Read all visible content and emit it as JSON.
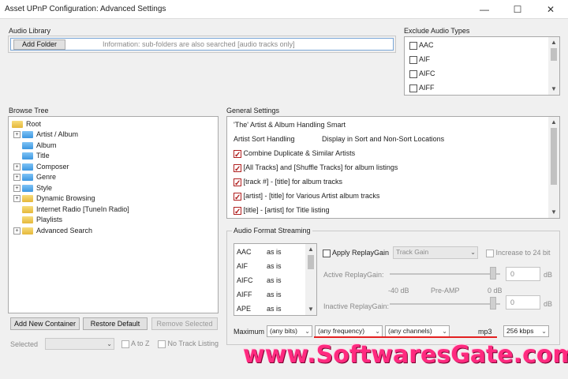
{
  "window": {
    "title": "Asset UPnP Configuration: Advanced Settings",
    "minimize": "—",
    "maximize": "☐",
    "close": "✕"
  },
  "audio_library": {
    "label": "Audio Library",
    "add_folder": "Add Folder",
    "info": "Information: sub-folders are also searched [audio tracks only]"
  },
  "exclude_audio_types": {
    "label": "Exclude Audio Types",
    "items": [
      "AAC",
      "AIF",
      "AIFC",
      "AIFF"
    ]
  },
  "browse_tree": {
    "label": "Browse Tree",
    "root": "Root",
    "items": [
      {
        "label": "Artist / Album",
        "expand": "+",
        "color": "blue"
      },
      {
        "label": "Album",
        "expand": "",
        "color": "blue"
      },
      {
        "label": "Title",
        "expand": "",
        "color": "blue"
      },
      {
        "label": "Composer",
        "expand": "+",
        "color": "blue"
      },
      {
        "label": "Genre",
        "expand": "+",
        "color": "blue"
      },
      {
        "label": "Style",
        "expand": "+",
        "color": "blue"
      },
      {
        "label": "Dynamic Browsing",
        "expand": "+",
        "color": "yellow"
      },
      {
        "label": "Internet Radio [TuneIn Radio]",
        "expand": "",
        "color": "yellow"
      },
      {
        "label": "Playlists",
        "expand": "",
        "color": "yellow"
      },
      {
        "label": "Advanced Search",
        "expand": "+",
        "color": "yellow"
      }
    ],
    "add_container": "Add New Container",
    "restore_default": "Restore Default",
    "remove_selected": "Remove Selected",
    "selected_label": "Selected",
    "a_to_z": "A to Z",
    "no_track_listing": "No Track Listing"
  },
  "general_settings": {
    "label": "General Settings",
    "rows": [
      {
        "text": "'The' Artist & Album Handling",
        "value": "Smart",
        "checkbox": false
      },
      {
        "text": "Artist Sort Handling",
        "value": "Display in Sort and Non-Sort Locations",
        "checkbox": false
      },
      {
        "text": "Combine Duplicate & Similar Artists",
        "value": "",
        "checkbox": true
      },
      {
        "text": "[All Tracks] and [Shuffle Tracks] for album listings",
        "value": "",
        "checkbox": true
      },
      {
        "text": "[track #] - [title] for album tracks",
        "value": "",
        "checkbox": true
      },
      {
        "text": "[artist] - [title] for Various Artist album tracks",
        "value": "",
        "checkbox": true
      },
      {
        "text": "[title] - [artist] for Title listing",
        "value": "",
        "checkbox": true
      }
    ]
  },
  "audio_format_streaming": {
    "label": "Audio Format Streaming",
    "formats": [
      {
        "name": "AAC",
        "mode": "as is"
      },
      {
        "name": "AIF",
        "mode": "as is"
      },
      {
        "name": "AIFC",
        "mode": "as is"
      },
      {
        "name": "AIFF",
        "mode": "as is"
      },
      {
        "name": "APE",
        "mode": "as is"
      }
    ],
    "apply_replaygain": "Apply ReplayGain",
    "track_gain": "Track Gain",
    "increase_24bit": "Increase to 24 bit",
    "active_replaygain": "Active ReplayGain:",
    "inactive_replaygain": "Inactive ReplayGain:",
    "minus40": "-40 dB",
    "preamp": "Pre-AMP",
    "zero_db": "0 dB",
    "active_value": "0",
    "inactive_value": "0",
    "db_unit": "dB",
    "maximum_label": "Maximum",
    "bits": "(any bits)",
    "frequency": "(any frequency)",
    "channels": "(any channels)",
    "format": "mp3",
    "bitrate": "256 kbps"
  },
  "watermark": "www.SoftwaresGate.com"
}
